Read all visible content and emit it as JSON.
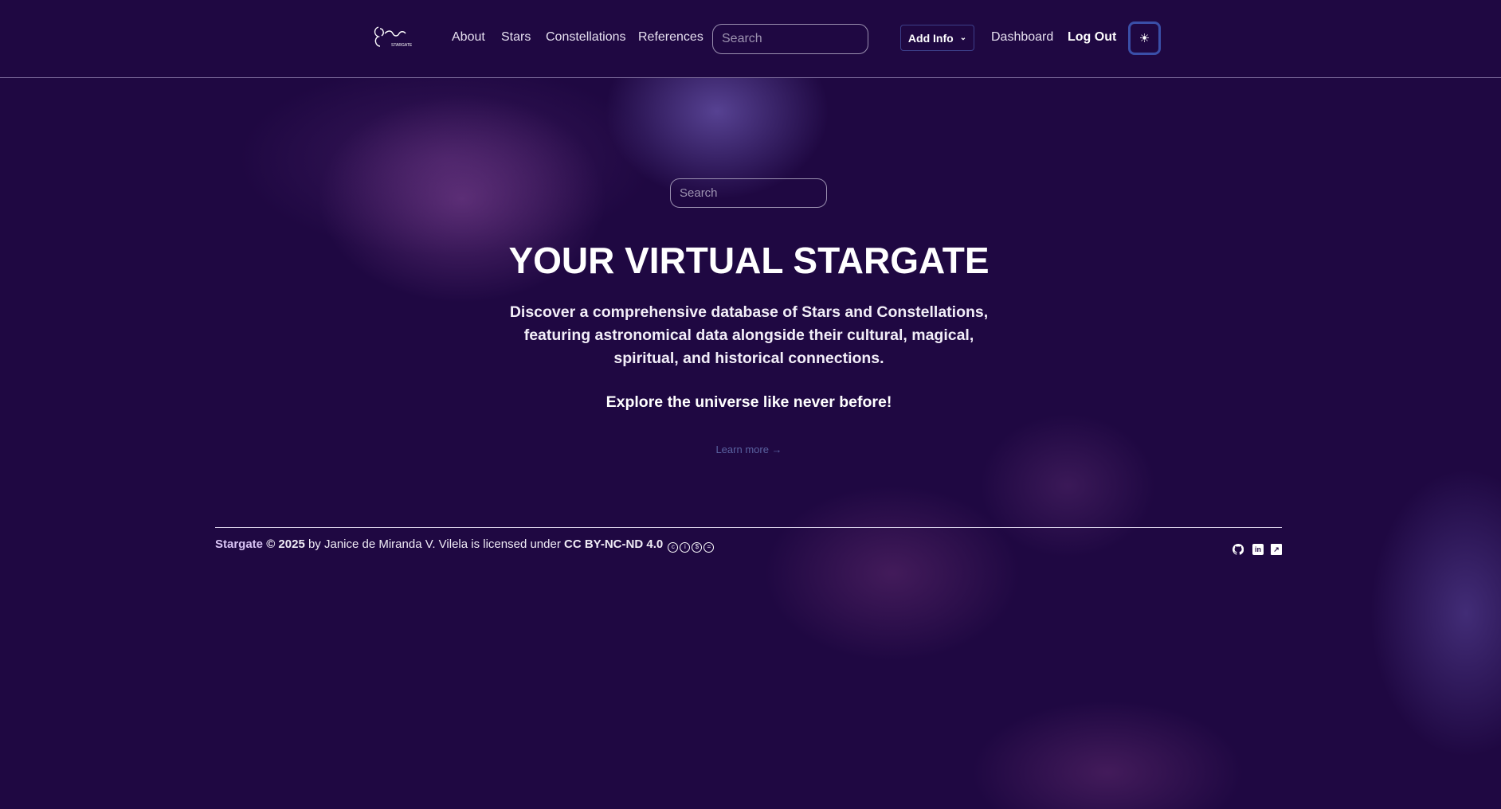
{
  "nav": {
    "logo_text": "Stargate",
    "links": [
      "About",
      "Stars",
      "Constellations",
      "References"
    ],
    "search_placeholder": "Search",
    "add_info": "Add Info",
    "dashboard": "Dashboard",
    "logout": "Log Out"
  },
  "hero": {
    "search_placeholder": "Search",
    "title": "YOUR VIRTUAL STARGATE",
    "description": "Discover a comprehensive database of Stars and Constellations, featuring astronomical data alongside their cultural, magical, spiritual, and historical connections.",
    "tagline": "Explore the universe like never before!",
    "learn_more": "Learn more →"
  },
  "footer": {
    "brand": "Stargate",
    "copyright": "© 2025",
    "by_text": "by Janice de Miranda V. Vilela is licensed under",
    "license": "CC BY-NC-ND 4.0",
    "cc_icons": [
      "cc-icon",
      "by-icon",
      "nc-icon",
      "nd-icon"
    ],
    "social": [
      "github-icon",
      "linkedin-icon",
      "link-icon"
    ]
  }
}
